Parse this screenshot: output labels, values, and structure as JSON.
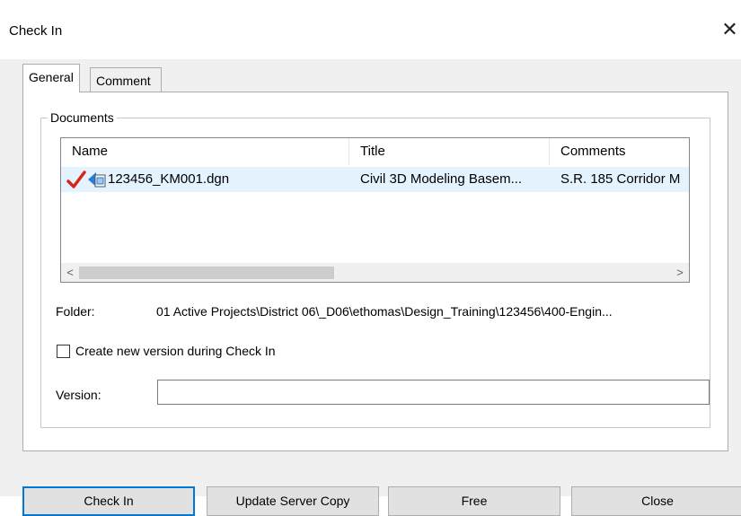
{
  "window": {
    "title": "Check In",
    "close_glyph": "✕"
  },
  "tabs": [
    {
      "label": "General",
      "active": true
    },
    {
      "label": "Comment",
      "active": false
    }
  ],
  "documents": {
    "group_label": "Documents",
    "columns": [
      "Name",
      "Title",
      "Comments"
    ],
    "rows": [
      {
        "status_icon": "checked-out-checkmark-icon",
        "file_icon": "dgn-file-icon",
        "name": "123456_KM001.dgn",
        "title": "Civil 3D Modeling Basem...",
        "comments": "S.R. 185 Corridor M"
      }
    ],
    "scroll_left": "<",
    "scroll_right": ">"
  },
  "folder": {
    "label": "Folder:",
    "value": "01 Active Projects\\District 06\\_D06\\ethomas\\Design_Training\\123456\\400-Engin..."
  },
  "create_version": {
    "label": "Create new version during Check In",
    "checked": false
  },
  "version": {
    "label": "Version:",
    "value": ""
  },
  "buttons": {
    "check_in": "Check In",
    "update_server_copy": "Update Server Copy",
    "free": "Free",
    "close": "Close"
  },
  "colors": {
    "accent_blue": "#0078d7",
    "check_red": "#d9261c",
    "selected_row": "#e5f3ff"
  }
}
